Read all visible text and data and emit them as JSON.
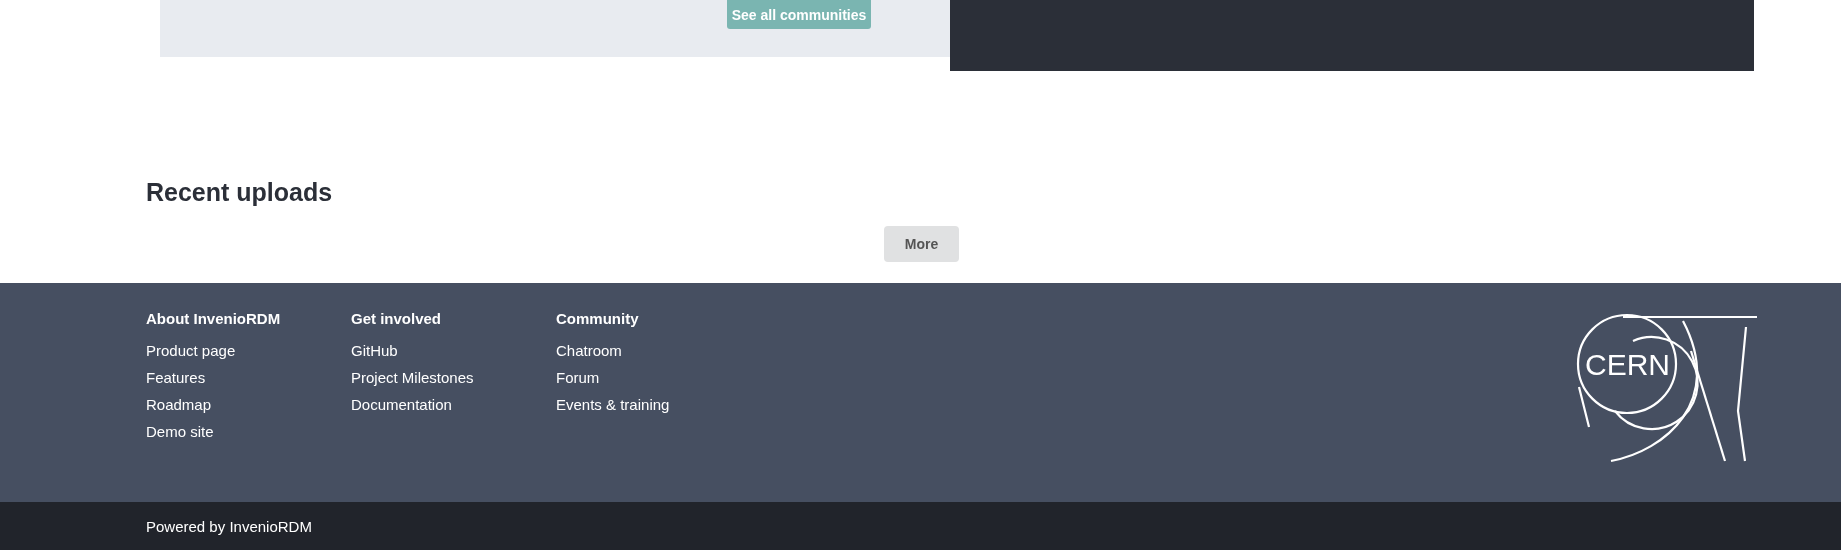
{
  "communities_panel": {
    "button": "See all communities"
  },
  "recent_uploads": {
    "title": "Recent uploads",
    "more_button": "More"
  },
  "footer": {
    "columns": [
      {
        "heading": "About InvenioRDM",
        "links": [
          "Product page",
          "Features",
          "Roadmap",
          "Demo site"
        ]
      },
      {
        "heading": "Get involved",
        "links": [
          "GitHub",
          "Project Milestones",
          "Documentation"
        ]
      },
      {
        "heading": "Community",
        "links": [
          "Chatroom",
          "Forum",
          "Events & training"
        ]
      }
    ],
    "logo_text": "CERN"
  },
  "bottom_bar": {
    "text": "Powered by InvenioRDM"
  }
}
